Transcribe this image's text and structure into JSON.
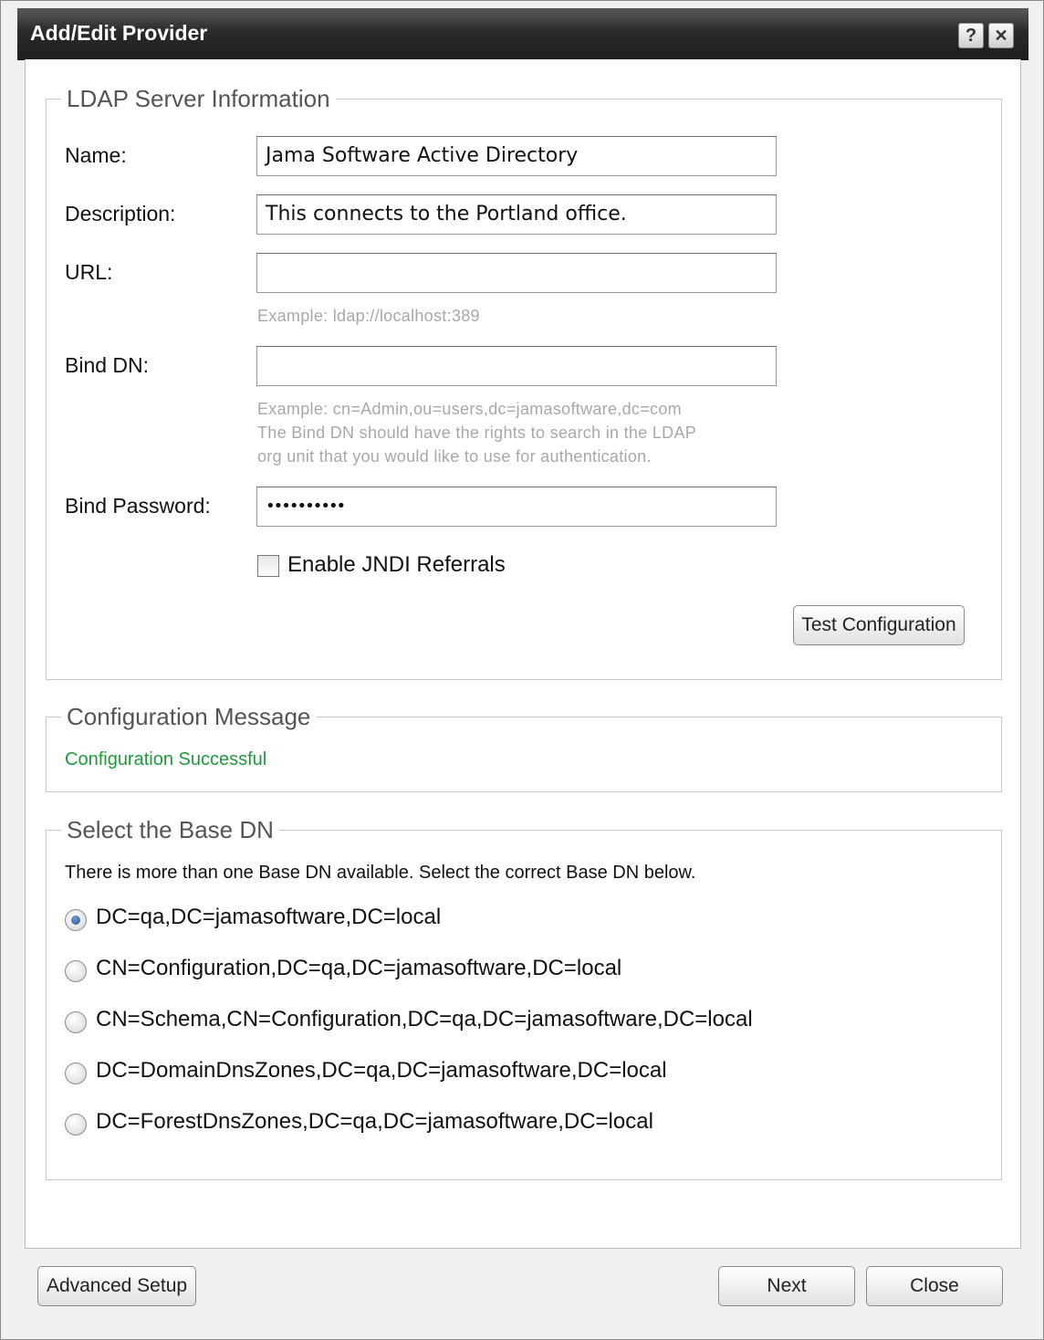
{
  "window": {
    "title": "Add/Edit Provider",
    "help_label": "?",
    "close_label": "✕"
  },
  "ldap": {
    "legend": "LDAP Server Information",
    "name_label": "Name:",
    "name_value": "Jama Software Active Directory",
    "description_label": "Description:",
    "description_value": "This connects to the Portland office.",
    "url_label": "URL:",
    "url_value": "",
    "url_hint": "Example: ldap://localhost:389",
    "bind_dn_label": "Bind DN:",
    "bind_dn_value": "",
    "bind_dn_hint_1": "Example: cn=Admin,ou=users,dc=jamasoftware,dc=com",
    "bind_dn_hint_2": "The Bind DN should have the rights to search in the LDAP",
    "bind_dn_hint_3": "org unit that you would like to use for authentication.",
    "bind_password_label": "Bind Password:",
    "bind_password_value": "••••••••••",
    "jndi_label": "Enable JNDI Referrals",
    "test_button": "Test Configuration"
  },
  "config_message": {
    "legend": "Configuration Message",
    "text": "Configuration Successful",
    "success_color": "#1e9a3a"
  },
  "base_dn": {
    "legend": "Select the Base DN",
    "instruction": "There is more than one Base DN available. Select the correct Base DN below.",
    "options": [
      {
        "label": "DC=qa,DC=jamasoftware,DC=local",
        "selected": true
      },
      {
        "label": "CN=Configuration,DC=qa,DC=jamasoftware,DC=local",
        "selected": false
      },
      {
        "label": "CN=Schema,CN=Configuration,DC=qa,DC=jamasoftware,DC=local",
        "selected": false
      },
      {
        "label": "DC=DomainDnsZones,DC=qa,DC=jamasoftware,DC=local",
        "selected": false
      },
      {
        "label": "DC=ForestDnsZones,DC=qa,DC=jamasoftware,DC=local",
        "selected": false
      }
    ]
  },
  "footer": {
    "advanced_button": "Advanced Setup",
    "next_button": "Next",
    "close_button": "Close"
  }
}
